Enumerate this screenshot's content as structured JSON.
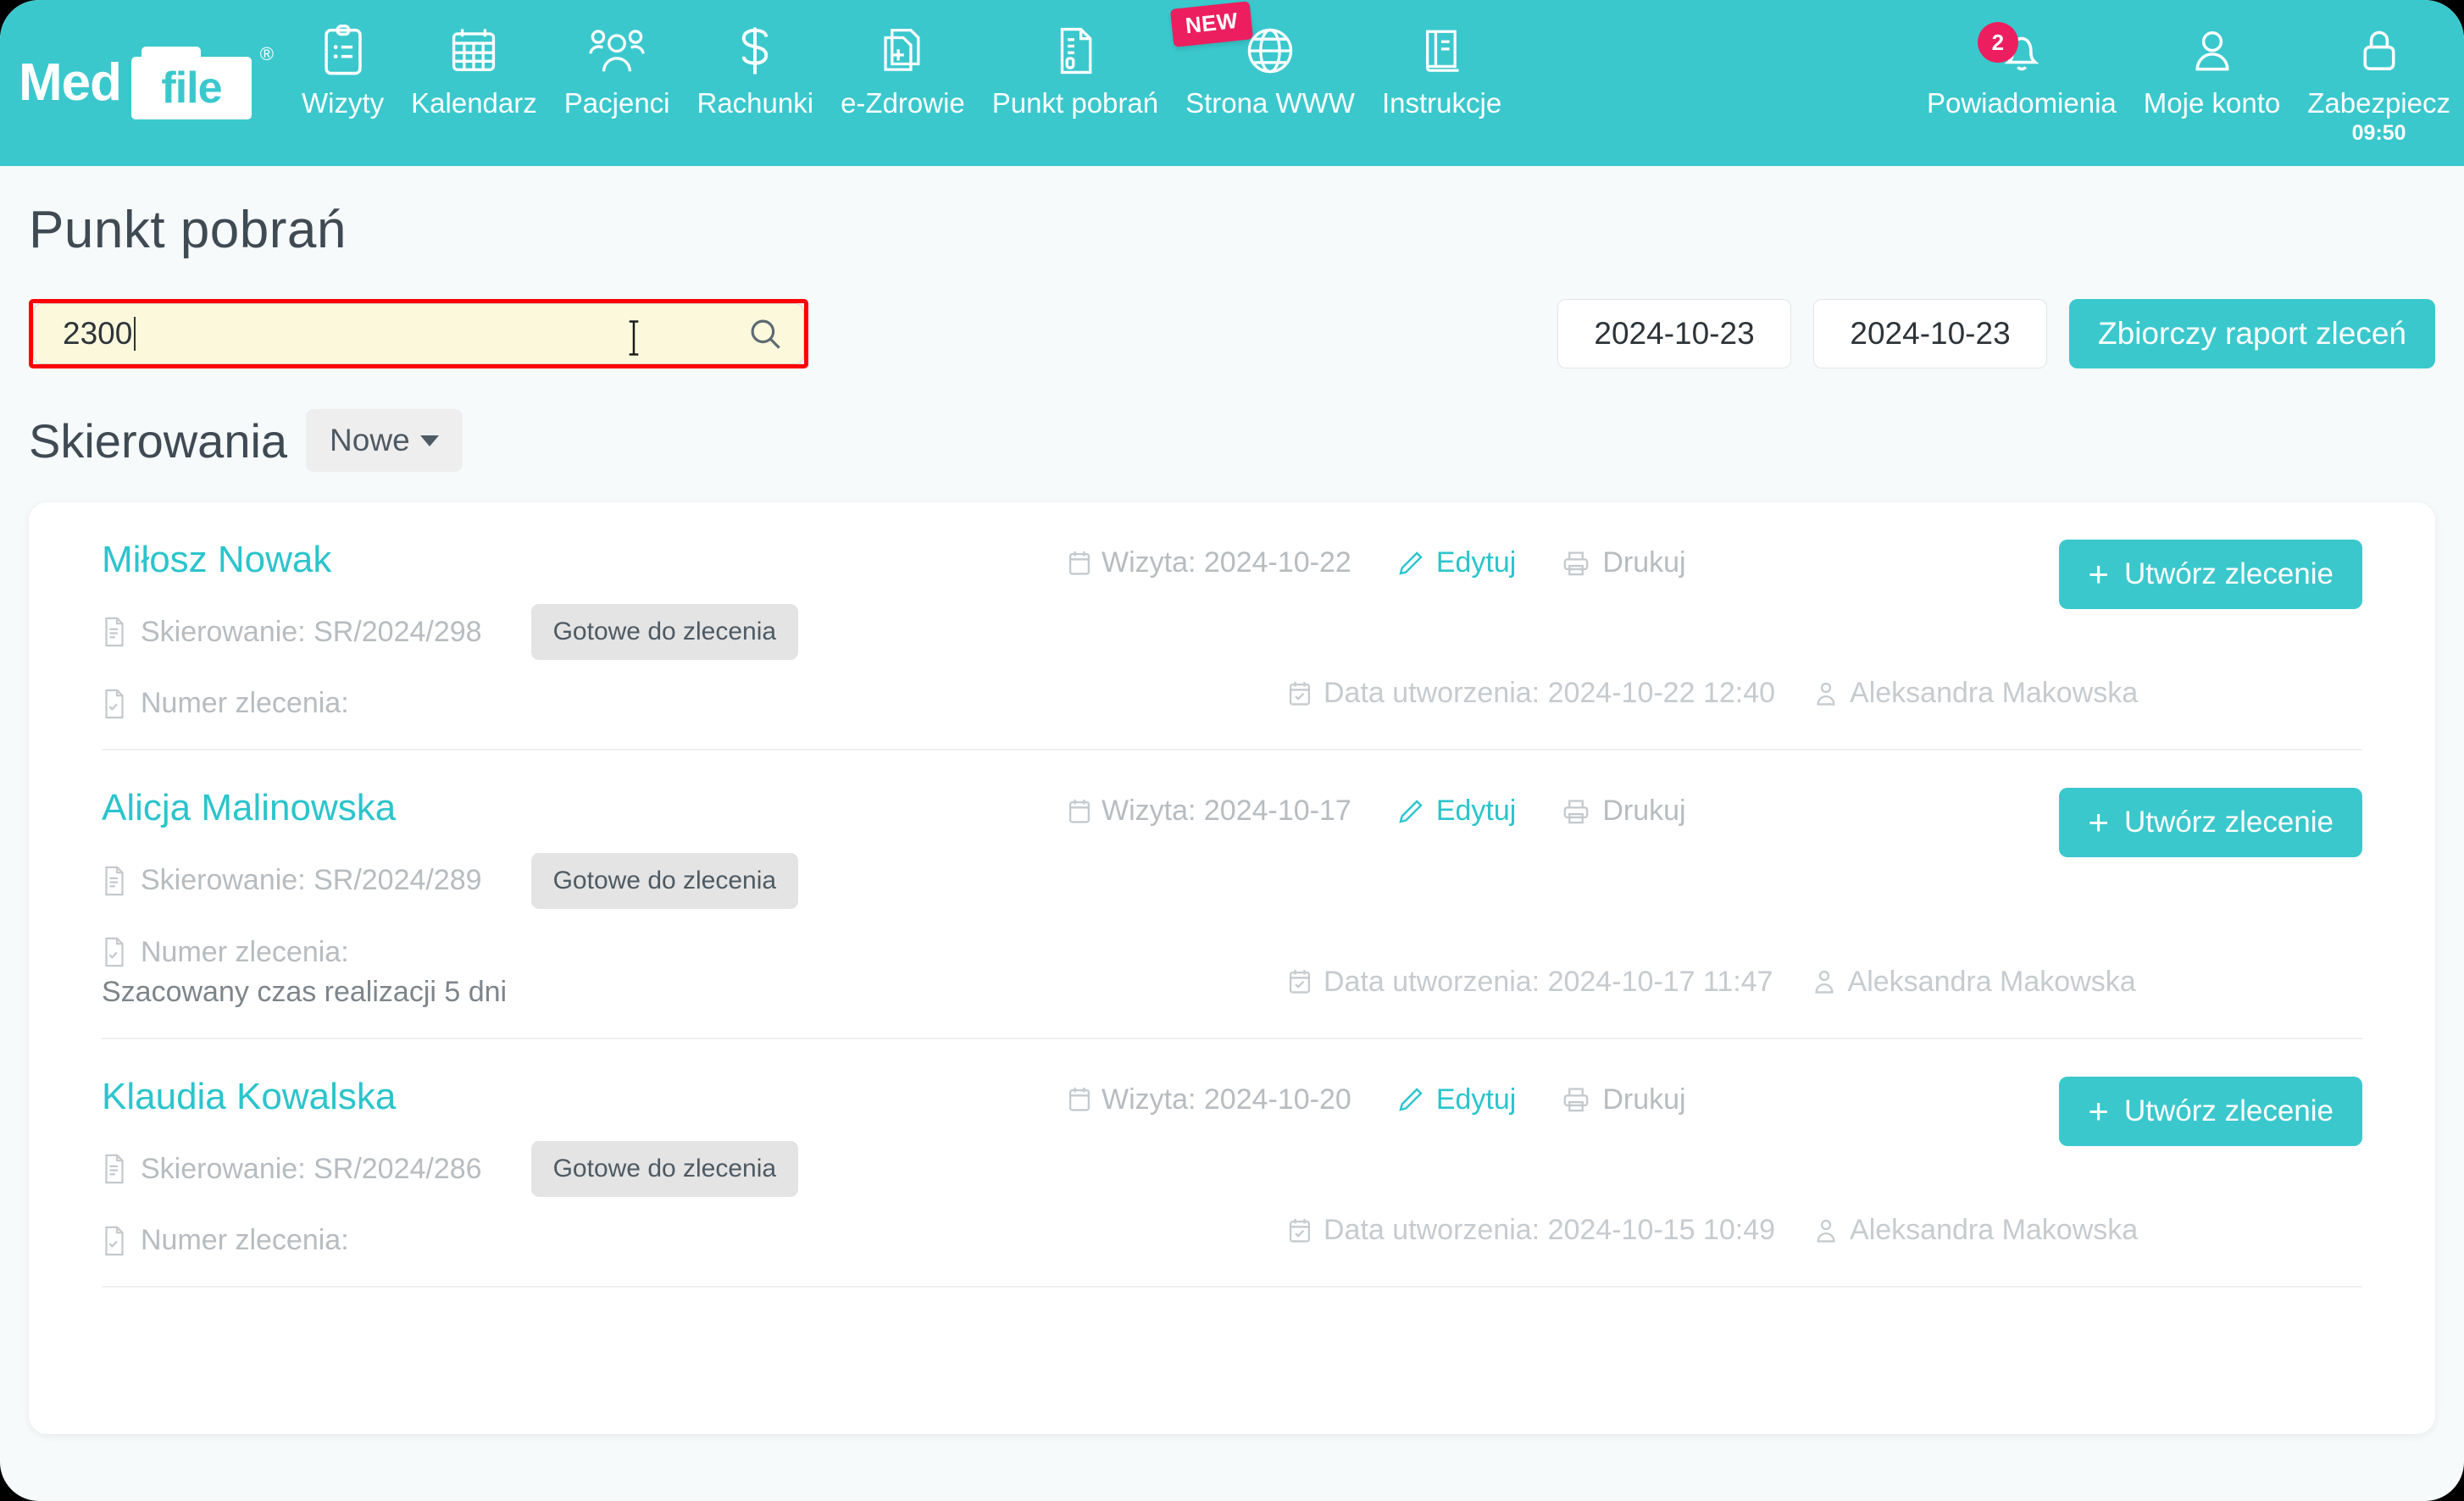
{
  "brand": {
    "logo_text_1": "Med",
    "logo_text_2": "file",
    "registered_mark": "®",
    "accent_color": "#3ac8cd",
    "badge_color": "#ed1e5f",
    "link_color": "#2bc4cc"
  },
  "nav": {
    "items": [
      {
        "label": "Wizyty",
        "icon": "clipboard-list-icon"
      },
      {
        "label": "Kalendarz",
        "icon": "calendar-icon"
      },
      {
        "label": "Pacjenci",
        "icon": "users-icon"
      },
      {
        "label": "Rachunki",
        "icon": "dollar-icon"
      },
      {
        "label": "e-Zdrowie",
        "icon": "medical-file-plus-icon"
      },
      {
        "label": "Punkt pobrań",
        "icon": "document-icon"
      },
      {
        "label": "Strona WWW",
        "icon": "globe-icon",
        "badge": "NEW"
      },
      {
        "label": "Instrukcje",
        "icon": "book-icon"
      }
    ],
    "right_items": [
      {
        "label": "Powiadomienia",
        "icon": "bell-icon",
        "count": "2"
      },
      {
        "label": "Moje konto",
        "icon": "user-icon"
      },
      {
        "label": "Zabezpiecz",
        "icon": "lock-icon",
        "sub": "09:50"
      }
    ]
  },
  "page": {
    "title": "Punkt pobrań",
    "section_title": "Skierowania",
    "filter_button": "Nowe"
  },
  "search": {
    "value": "2300",
    "placeholder": "",
    "icon": "search-icon"
  },
  "toolbar": {
    "date_from": "2024-10-23",
    "date_to": "2024-10-23",
    "report_label": "Zbiorczy raport zleceń"
  },
  "labels": {
    "referral_prefix": "Skierowanie:",
    "order_number_prefix": "Numer zlecenia:",
    "visit_prefix": "Wizyta:",
    "created_prefix": "Data utworzenia:",
    "edit": "Edytuj",
    "print": "Drukuj",
    "create_order": "Utwórz zlecenie",
    "plus": "+"
  },
  "rows": [
    {
      "patient": "Miłosz Nowak",
      "referral": "Skierowanie: SR/2024/298",
      "status": "Gotowe do zlecenia",
      "order_number": "Numer zlecenia:",
      "extra": "",
      "visit": "Wizyta: 2024-10-22",
      "edit": "Edytuj",
      "print": "Drukuj",
      "create": "Utwórz zlecenie",
      "created": "Data utworzenia: 2024-10-22 12:40",
      "author": "Aleksandra Makowska"
    },
    {
      "patient": "Alicja Malinowska",
      "referral": "Skierowanie: SR/2024/289",
      "status": "Gotowe do zlecenia",
      "order_number": "Numer zlecenia:",
      "extra": "Szacowany czas realizacji 5 dni",
      "visit": "Wizyta: 2024-10-17",
      "edit": "Edytuj",
      "print": "Drukuj",
      "create": "Utwórz zlecenie",
      "created": "Data utworzenia: 2024-10-17 11:47",
      "author": "Aleksandra Makowska"
    },
    {
      "patient": "Klaudia Kowalska",
      "referral": "Skierowanie: SR/2024/286",
      "status": "Gotowe do zlecenia",
      "order_number": "Numer zlecenia:",
      "extra": "",
      "visit": "Wizyta: 2024-10-20",
      "edit": "Edytuj",
      "print": "Drukuj",
      "create": "Utwórz zlecenie",
      "created": "Data utworzenia: 2024-10-15 10:49",
      "author": "Aleksandra Makowska"
    }
  ]
}
